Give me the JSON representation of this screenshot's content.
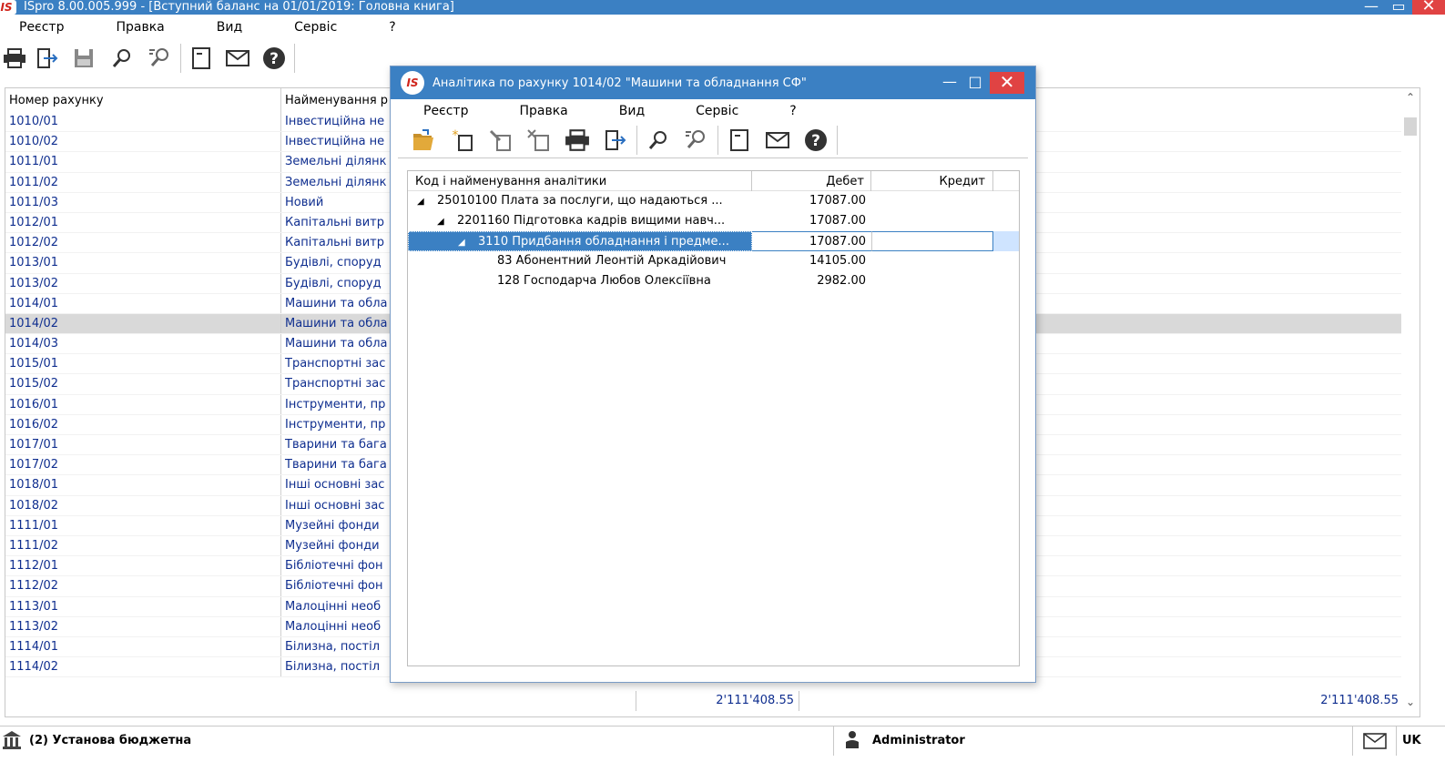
{
  "app": {
    "logo": "IS",
    "title": "ISpro 8.00.005.999 - [Вступний баланс на 01/01/2019: Головна книга]",
    "menu": [
      "Реєстр",
      "Правка",
      "Вид",
      "Сервіс",
      "?"
    ],
    "toolbar_icons": [
      "print-icon",
      "exit-icon",
      "save-icon",
      "search-icon",
      "search-next-icon",
      "document-icon",
      "mail-icon",
      "help-icon"
    ]
  },
  "table": {
    "columns": [
      "Номер рахунку",
      "Найменування р"
    ],
    "rows": [
      {
        "code": "1010/01",
        "name": "Інвестиційна не"
      },
      {
        "code": "1010/02",
        "name": "Інвестиційна не"
      },
      {
        "code": "1011/01",
        "name": "Земельні ділянк"
      },
      {
        "code": "1011/02",
        "name": "Земельні ділянк"
      },
      {
        "code": "1011/03",
        "name": "Новий"
      },
      {
        "code": "1012/01",
        "name": "Капітальні витр"
      },
      {
        "code": "1012/02",
        "name": "Капітальні витр"
      },
      {
        "code": "1013/01",
        "name": "Будівлі, споруд"
      },
      {
        "code": "1013/02",
        "name": "Будівлі, споруд"
      },
      {
        "code": "1014/01",
        "name": "Машини та обла"
      },
      {
        "code": "1014/02",
        "name": "Машини та обла"
      },
      {
        "code": "1014/03",
        "name": "Машини та обла"
      },
      {
        "code": "1015/01",
        "name": "Транспортні зас"
      },
      {
        "code": "1015/02",
        "name": "Транспортні зас"
      },
      {
        "code": "1016/01",
        "name": "Інструменти, пр"
      },
      {
        "code": "1016/02",
        "name": "Інструменти, пр"
      },
      {
        "code": "1017/01",
        "name": "Тварини та бага"
      },
      {
        "code": "1017/02",
        "name": "Тварини та бага"
      },
      {
        "code": "1018/01",
        "name": "Інші основні зас"
      },
      {
        "code": "1018/02",
        "name": "Інші основні зас"
      },
      {
        "code": "1111/01",
        "name": "Музейні фонди"
      },
      {
        "code": "1111/02",
        "name": "Музейні фонди"
      },
      {
        "code": "1112/01",
        "name": "Бібліотечні фон"
      },
      {
        "code": "1112/02",
        "name": "Бібліотечні фон"
      },
      {
        "code": "1113/01",
        "name": "Малоцінні необ"
      },
      {
        "code": "1113/02",
        "name": "Малоцінні необ"
      },
      {
        "code": "1114/01",
        "name": "Білизна, постіл"
      },
      {
        "code": "1114/02",
        "name": "Білизна, постіл"
      }
    ],
    "selected_index": 10,
    "total_debit": "2'111'408.55",
    "total_credit": "2'111'408.55"
  },
  "status": {
    "organization": "(2) Установа бюджетна",
    "user": "Administrator",
    "language": "UK"
  },
  "dialog": {
    "logo": "IS",
    "title": "Аналітика по рахунку   1014/02 \"Машини та обладнання СФ\"",
    "menu": [
      "Реєстр",
      "Правка",
      "Вид",
      "Сервіс",
      "?"
    ],
    "toolbar_icons": [
      "folder-open-icon",
      "new-document-icon",
      "edit-document-icon",
      "delete-document-icon",
      "print-icon",
      "exit-icon",
      "search-icon",
      "search-next-icon",
      "document-icon",
      "mail-icon",
      "help-icon"
    ],
    "columns": {
      "name": "Код і найменування аналітики",
      "debit": "Дебет",
      "credit": "Кредит"
    },
    "rows": [
      {
        "level": 0,
        "expanded": true,
        "name": "25010100 Плата за послуги, що надаються ...",
        "debit": "17087.00",
        "credit": ""
      },
      {
        "level": 1,
        "expanded": true,
        "name": "2201160 Підготовка кадрів вищими навч...",
        "debit": "17087.00",
        "credit": ""
      },
      {
        "level": 2,
        "expanded": true,
        "name": "3110 Придбання обладнання і предме...",
        "debit": "17087.00",
        "credit": ""
      },
      {
        "level": 3,
        "expanded": false,
        "name": "83 Абонентний Леонтій Аркадійович",
        "debit": "14105.00",
        "credit": ""
      },
      {
        "level": 3,
        "expanded": false,
        "name": "128 Господарча Любов Олексіївна",
        "debit": "2982.00",
        "credit": ""
      }
    ],
    "selected_index": 2,
    "tree_marker": "◢"
  },
  "colors": {
    "titlebar": "#3b80c3",
    "close": "#e04343",
    "link_text": "#0f2e8f",
    "selection": "#d9d9d9"
  }
}
